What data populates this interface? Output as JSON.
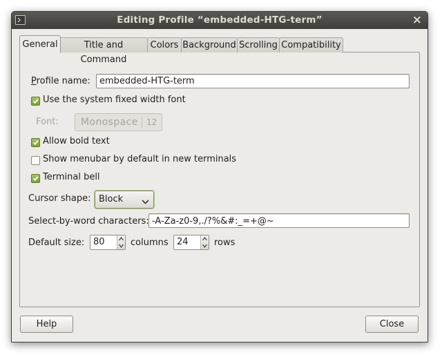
{
  "window": {
    "title": "Editing Profile “embedded-HTG-term”"
  },
  "tabs": [
    "General",
    "Title and Command",
    "Colors",
    "Background",
    "Scrolling",
    "Compatibility"
  ],
  "general": {
    "profile_name_label": "Profile name:",
    "profile_name_value": "embedded-HTG-term",
    "use_system_font_label": "Use the system fixed width font",
    "use_system_font_checked": true,
    "font_label": "Font:",
    "font_name": "Monospace",
    "font_size": "12",
    "allow_bold_label": "Allow bold text",
    "allow_bold_checked": true,
    "show_menubar_label": "Show menubar by default in new terminals",
    "show_menubar_checked": false,
    "terminal_bell_label": "Terminal bell",
    "terminal_bell_checked": true,
    "cursor_shape_label": "Cursor shape:",
    "cursor_shape_value": "Block",
    "select_by_word_label": "Select-by-word characters:",
    "select_by_word_value": "-A-Za-z0-9,./?%&#:_=+@~",
    "default_size_label": "Default size:",
    "columns_value": "80",
    "columns_label": "columns",
    "rows_value": "24",
    "rows_label": "rows"
  },
  "buttons": {
    "help": "Help",
    "close": "Close"
  },
  "colors": {
    "titlebar": "#3e3d39",
    "window_bg": "#edebe8",
    "check_on": "#7ea13d"
  }
}
